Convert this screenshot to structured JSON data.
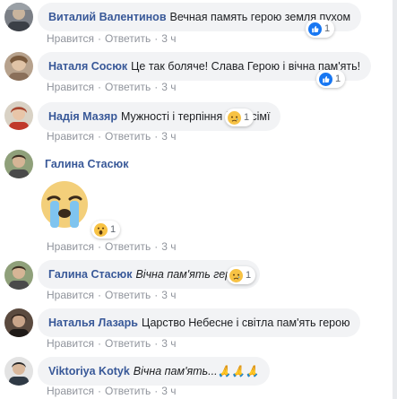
{
  "colors": {
    "name": "#385898",
    "bubble": "#f2f3f5",
    "meta": "#90949c",
    "like_blue": "#1877f2"
  },
  "comments": [
    {
      "author": "Виталий Валентинов",
      "text": "Вечная память герою земля пухом",
      "reaction": {
        "icon": "like-icon",
        "count": "1"
      },
      "actions": {
        "like": "Нравится",
        "reply": "Ответить",
        "time": "3 ч"
      }
    },
    {
      "author": "Наталя Сосюк",
      "text": "Це так боляче! Слава Герою і вічна пам'ять!",
      "reaction": {
        "icon": "like-icon",
        "count": "1"
      },
      "actions": {
        "like": "Нравится",
        "reply": "Ответить",
        "time": "3 ч"
      }
    },
    {
      "author": "Надія Мазяр",
      "text": "Мужності і терпіння його сімї",
      "reaction": {
        "icon": "sad-icon",
        "count": "1"
      },
      "actions": {
        "like": "Нравится",
        "reply": "Ответить",
        "time": "3 ч"
      }
    },
    {
      "author": "Галина Стасюк",
      "text": "",
      "sticker": "crying-face-sticker",
      "reaction": {
        "icon": "wow-icon",
        "count": "1"
      },
      "actions": {
        "like": "Нравится",
        "reply": "Ответить",
        "time": "3 ч"
      }
    },
    {
      "author": "Галина Стасюк",
      "text": "Вічна пам'ять герою.",
      "reaction": {
        "icon": "sad-icon",
        "count": "1"
      },
      "actions": {
        "like": "Нравится",
        "reply": "Ответить",
        "time": "3 ч"
      }
    },
    {
      "author": "Наталья Лазарь",
      "text": "Царство Небесне і світла пам'ять герою",
      "actions": {
        "like": "Нравится",
        "reply": "Ответить",
        "time": "3 ч"
      }
    },
    {
      "author": "Viktoriya Kotyk",
      "text": "Вічна пам'ять...🙏🙏🙏",
      "actions": {
        "like": "Нравится",
        "reply": "Ответить",
        "time": "3 ч"
      }
    }
  ]
}
